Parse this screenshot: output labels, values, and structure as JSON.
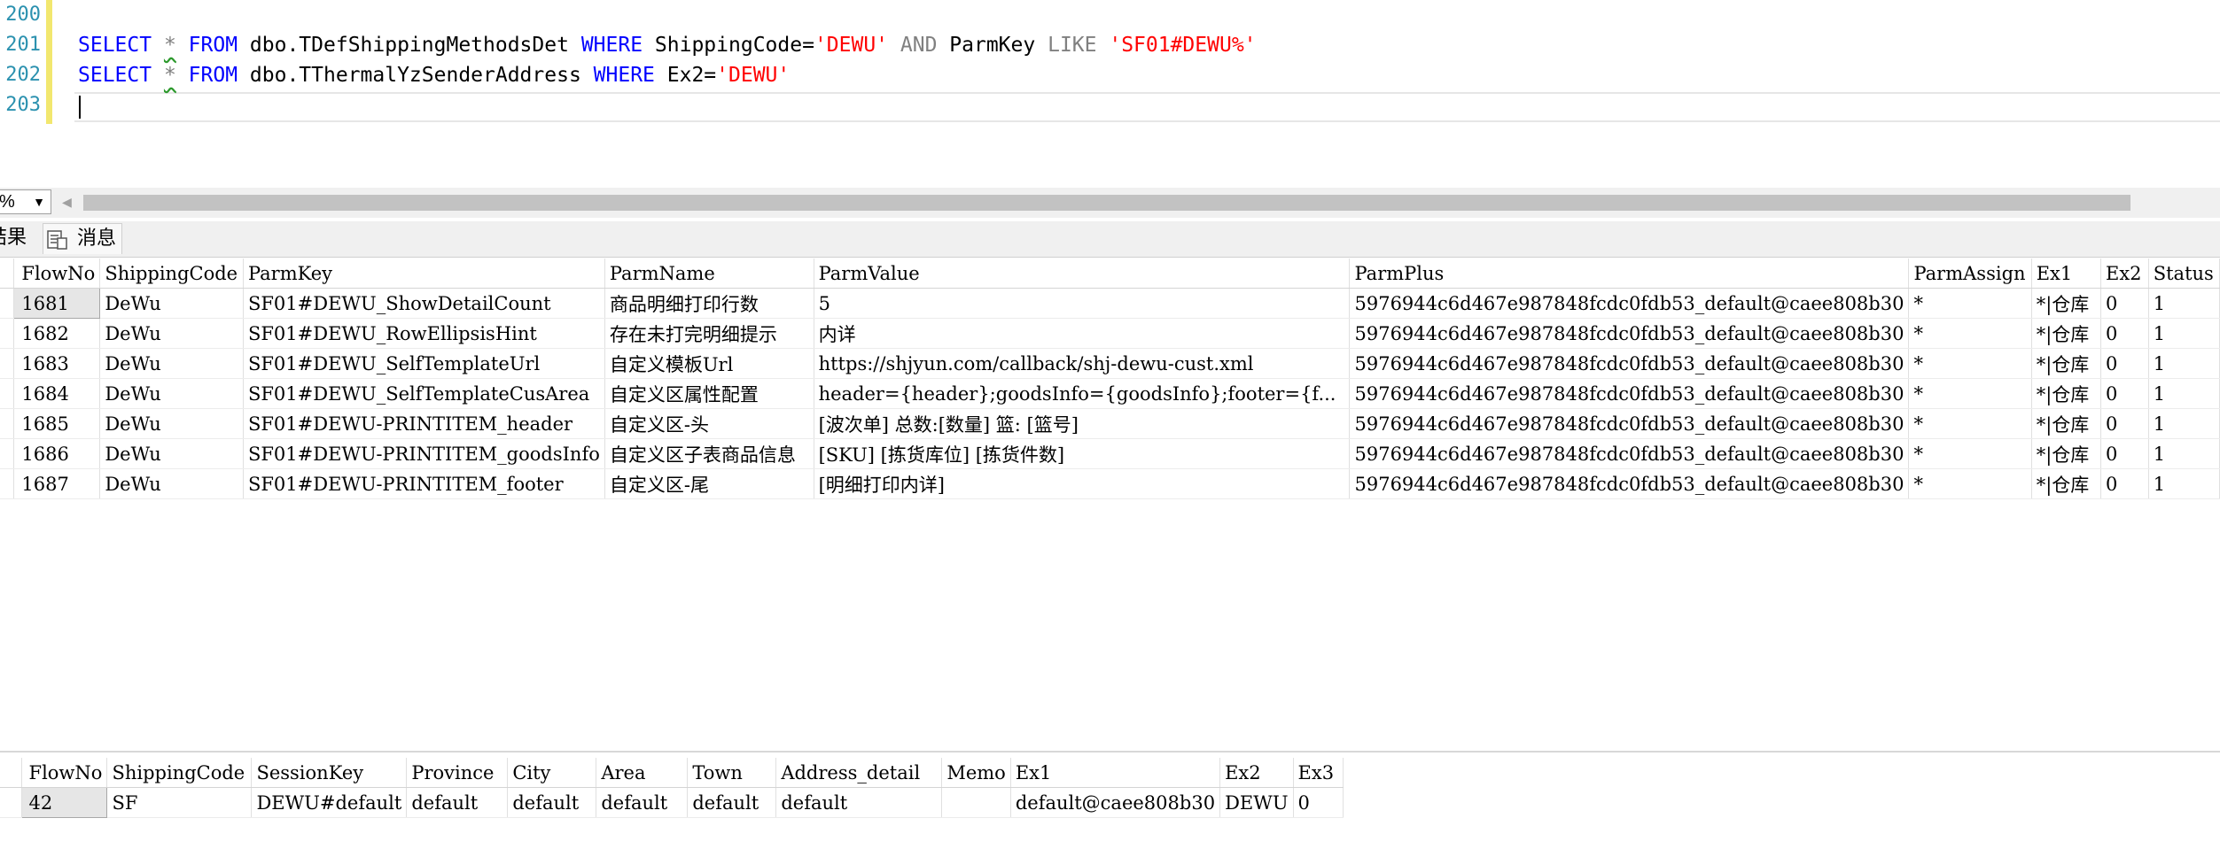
{
  "editor": {
    "line_numbers": [
      "200",
      "201",
      "202",
      "203"
    ],
    "line1": {
      "select": "SELECT",
      "star": "*",
      "from": "FROM",
      "table": "dbo.TDefShippingMethodsDet",
      "where": "WHERE",
      "col1": "ShippingCode=",
      "val1": "'DEWU'",
      "and": "AND",
      "col2": "ParmKey",
      "like": "LIKE",
      "val2": "'SF01#DEWU%'"
    },
    "line2": {
      "select": "SELECT",
      "star": "*",
      "from": "FROM",
      "table": "dbo.TThermalYzSenderAddress",
      "where": "WHERE",
      "col1": "Ex2=",
      "val1": "'DEWU'"
    }
  },
  "zoom": {
    "value": "%"
  },
  "tabs": {
    "results": "结果",
    "messages": "消息"
  },
  "colors": {
    "keyword": "#0000ff",
    "string": "#ff0000",
    "operator": "#808080",
    "line_number": "#2b91af"
  },
  "grid1": {
    "columns": [
      "FlowNo",
      "ShippingCode",
      "ParmKey",
      "ParmName",
      "ParmValue",
      "ParmPlus",
      "ParmAssign",
      "Ex1",
      "Ex2",
      "Status"
    ],
    "rows": [
      [
        "1681",
        "DeWu",
        "SF01#DEWU_ShowDetailCount",
        "商品明细打印行数",
        "5",
        "5976944c6d467e987848fcdc0fdb53_default@caee808b30",
        "*",
        "*|仓库",
        "0",
        "1"
      ],
      [
        "1682",
        "DeWu",
        "SF01#DEWU_RowEllipsisHint",
        "存在未打完明细提示",
        "内详",
        "5976944c6d467e987848fcdc0fdb53_default@caee808b30",
        "*",
        "*|仓库",
        "0",
        "1"
      ],
      [
        "1683",
        "DeWu",
        "SF01#DEWU_SelfTemplateUrl",
        "自定义模板Url",
        "https://shjyun.com/callback/shj-dewu-cust.xml",
        "5976944c6d467e987848fcdc0fdb53_default@caee808b30",
        "*",
        "*|仓库",
        "0",
        "1"
      ],
      [
        "1684",
        "DeWu",
        "SF01#DEWU_SelfTemplateCusArea",
        "自定义区属性配置",
        "header={header};goodsInfo={goodsInfo};footer={f...",
        "5976944c6d467e987848fcdc0fdb53_default@caee808b30",
        "*",
        "*|仓库",
        "0",
        "1"
      ],
      [
        "1685",
        "DeWu",
        "SF01#DEWU-PRINTITEM_header",
        "自定义区-头",
        "[波次单] 总数:[数量] 篮: [篮号]",
        "5976944c6d467e987848fcdc0fdb53_default@caee808b30",
        "*",
        "*|仓库",
        "0",
        "1"
      ],
      [
        "1686",
        "DeWu",
        "SF01#DEWU-PRINTITEM_goodsInfo",
        "自定义区子表商品信息",
        "[SKU]    [拣货库位]   [拣货件数]",
        "5976944c6d467e987848fcdc0fdb53_default@caee808b30",
        "*",
        "*|仓库",
        "0",
        "1"
      ],
      [
        "1687",
        "DeWu",
        "SF01#DEWU-PRINTITEM_footer",
        "自定义区-尾",
        " [明细打印内详]",
        "5976944c6d467e987848fcdc0fdb53_default@caee808b30",
        "*",
        "*|仓库",
        "0",
        "1"
      ]
    ]
  },
  "grid2": {
    "columns": [
      "FlowNo",
      "ShippingCode",
      "SessionKey",
      "Province",
      "City",
      "Area",
      "Town",
      "Address_detail",
      "Memo",
      "Ex1",
      "Ex2",
      "Ex3"
    ],
    "rows": [
      [
        "42",
        "SF",
        "DEWU#default",
        "default",
        "default",
        "default",
        "default",
        "default",
        "",
        "default@caee808b30",
        "DEWU",
        "0"
      ]
    ]
  }
}
